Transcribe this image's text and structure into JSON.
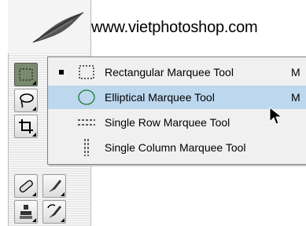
{
  "header": {
    "site_url": "www.vietphotoshop.com"
  },
  "toolbox": {
    "tools": [
      {
        "name": "marquee-tool",
        "active": true
      },
      {
        "name": "lasso-tool",
        "active": false
      },
      {
        "name": "crop-tool",
        "active": false
      },
      {
        "name": "healing-brush-tool",
        "active": false
      },
      {
        "name": "brush-tool",
        "active": false
      },
      {
        "name": "clone-stamp-tool",
        "active": false
      },
      {
        "name": "history-brush-tool",
        "active": false
      }
    ]
  },
  "flyout": {
    "items": [
      {
        "label": "Rectangular Marquee Tool",
        "shortcut": "M",
        "checked": true,
        "selected": false,
        "icon": "rectangular-marquee-icon"
      },
      {
        "label": "Elliptical Marquee Tool",
        "shortcut": "M",
        "checked": false,
        "selected": true,
        "icon": "elliptical-marquee-icon"
      },
      {
        "label": "Single Row Marquee Tool",
        "shortcut": "",
        "checked": false,
        "selected": false,
        "icon": "single-row-marquee-icon"
      },
      {
        "label": "Single Column Marquee Tool",
        "shortcut": "",
        "checked": false,
        "selected": false,
        "icon": "single-column-marquee-icon"
      }
    ]
  },
  "colors": {
    "selected_highlight": "#bdd7ef",
    "active_tool": "#7a8a70"
  }
}
